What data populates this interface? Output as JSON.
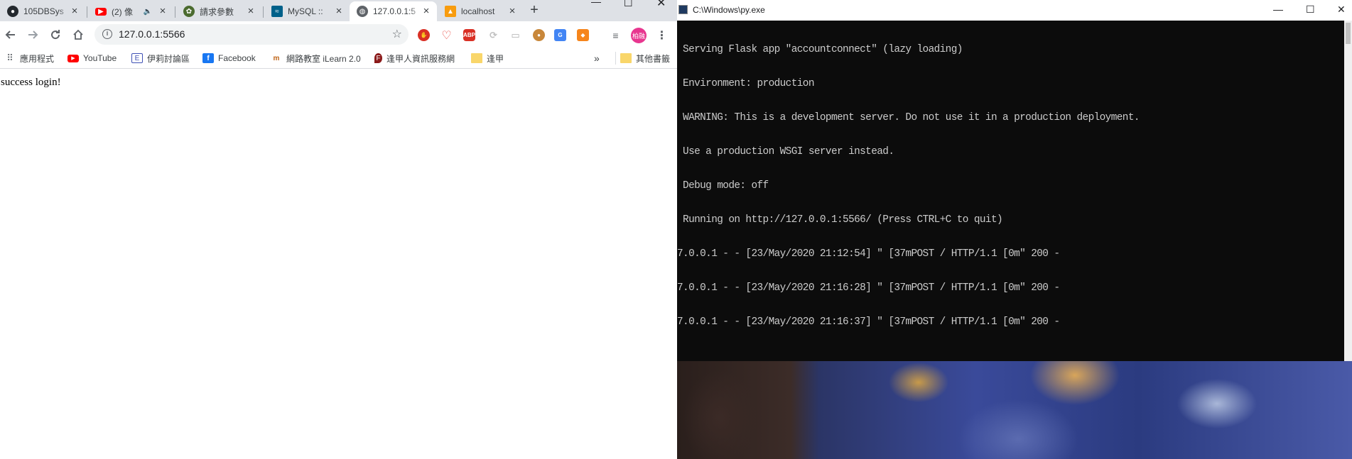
{
  "browser": {
    "tabs": [
      {
        "title": "105DBSys",
        "favicon": "github-icon",
        "color": "#24292e"
      },
      {
        "title": "(2) 像",
        "favicon": "youtube-icon",
        "color": "#ff0000"
      },
      {
        "title": "請求參數",
        "favicon": "flask-icon",
        "color": "#4b6b2f"
      },
      {
        "title": "MySQL :: ",
        "favicon": "mysql-icon",
        "color": "#00618a"
      },
      {
        "title": "127.0.0.1:5",
        "favicon": "globe-icon",
        "color": "#5f6368"
      },
      {
        "title": "localhost",
        "favicon": "phpmyadmin-icon",
        "color": "#f89c0e"
      }
    ],
    "active_tab_index": 4,
    "new_tab_label": "+",
    "address": {
      "url": "127.0.0.1:5566"
    },
    "bookmarks": [
      {
        "label": "應用程式",
        "icon": "apps-grid-icon"
      },
      {
        "label": "YouTube",
        "icon": "youtube-icon"
      },
      {
        "label": "伊莉討論區",
        "icon": "eyny-icon"
      },
      {
        "label": "Facebook",
        "icon": "facebook-icon"
      },
      {
        "label": "網路教室 iLearn 2.0",
        "icon": "ilearn-icon"
      },
      {
        "label": "逢甲人資訊服務網",
        "icon": "fcu-icon"
      },
      {
        "label": "逢甲",
        "icon": "folder-icon"
      }
    ],
    "bookmarks_overflow": "»",
    "other_bookmarks": "其他書籤",
    "profile_label": "柏融",
    "page_text": "success login!"
  },
  "console": {
    "title": "C:\\Windows\\py.exe",
    "lines": [
      " Serving Flask app \"accountconnect\" (lazy loading)",
      " Environment: production",
      " WARNING: This is a development server. Do not use it in a production deployment.",
      " Use a production WSGI server instead.",
      " Debug mode: off",
      " Running on http://127.0.0.1:5566/ (Press CTRL+C to quit)",
      "7.0.0.1 - - [23/May/2020 21:12:54] \" [37mPOST / HTTP/1.1 [0m\" 200 -",
      "7.0.0.1 - - [23/May/2020 21:16:28] \" [37mPOST / HTTP/1.1 [0m\" 200 -",
      "7.0.0.1 - - [23/May/2020 21:16:37] \" [37mPOST / HTTP/1.1 [0m\" 200 -"
    ]
  }
}
